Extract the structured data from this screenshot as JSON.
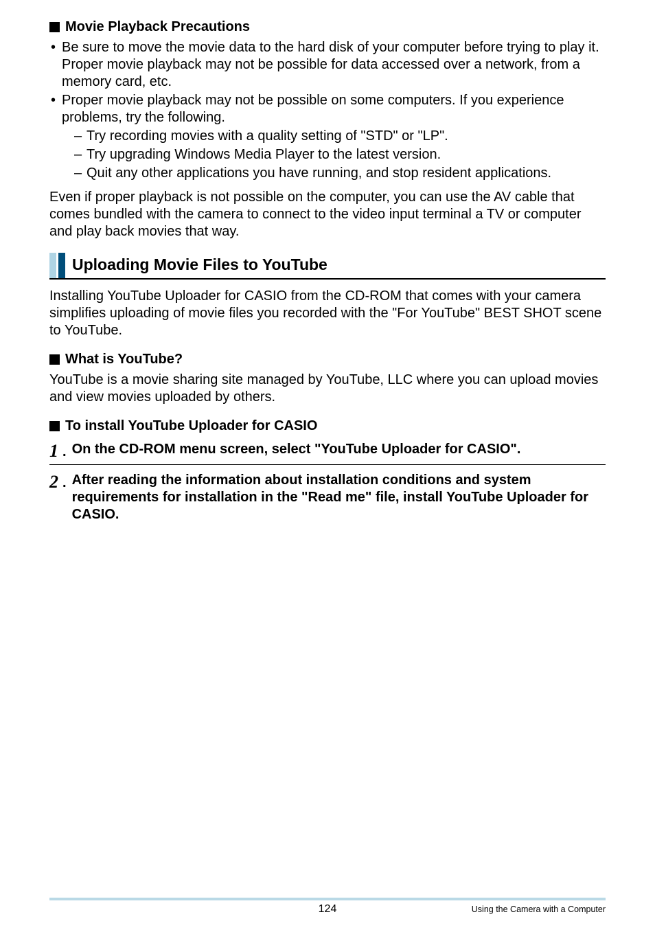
{
  "headings": {
    "movie_precautions": "Movie Playback Precautions",
    "uploading_section": "Uploading Movie Files to YouTube",
    "what_is_youtube": "What is YouTube?",
    "to_install": "To install YouTube Uploader for CASIO"
  },
  "bullets": {
    "b1": "Be sure to move the movie data to the hard disk of your computer before trying to play it. Proper movie playback may not be possible for data accessed over a network, from a memory card, etc.",
    "b2": "Proper movie playback may not be possible on some computers. If you experience problems, try the following.",
    "d1": "Try recording movies with a quality setting of \"STD\" or \"LP\".",
    "d2": "Try upgrading Windows Media Player to the latest version.",
    "d3": "Quit any other applications you have running, and stop resident applications."
  },
  "paragraphs": {
    "even_if": "Even if proper playback is not possible on the computer, you can use the AV cable that comes bundled with the camera to connect to the video input terminal a TV or computer and play back movies that way.",
    "installing": "Installing YouTube Uploader for CASIO from the CD-ROM that comes with your camera simplifies uploading of movie files you recorded with the \"For YouTube\" BEST SHOT scene to YouTube.",
    "youtube_is": "YouTube is a movie sharing site managed by YouTube, LLC where you can upload movies and view movies uploaded by others."
  },
  "steps": {
    "n1": "1",
    "n2": "2",
    "s1": "On the CD-ROM menu screen, select \"YouTube Uploader for CASIO\".",
    "s2": "After reading the information about installation conditions and system requirements for installation in the \"Read me\" file, install YouTube Uploader for CASIO."
  },
  "footer": {
    "page": "124",
    "text": "Using the Camera with a Computer"
  }
}
